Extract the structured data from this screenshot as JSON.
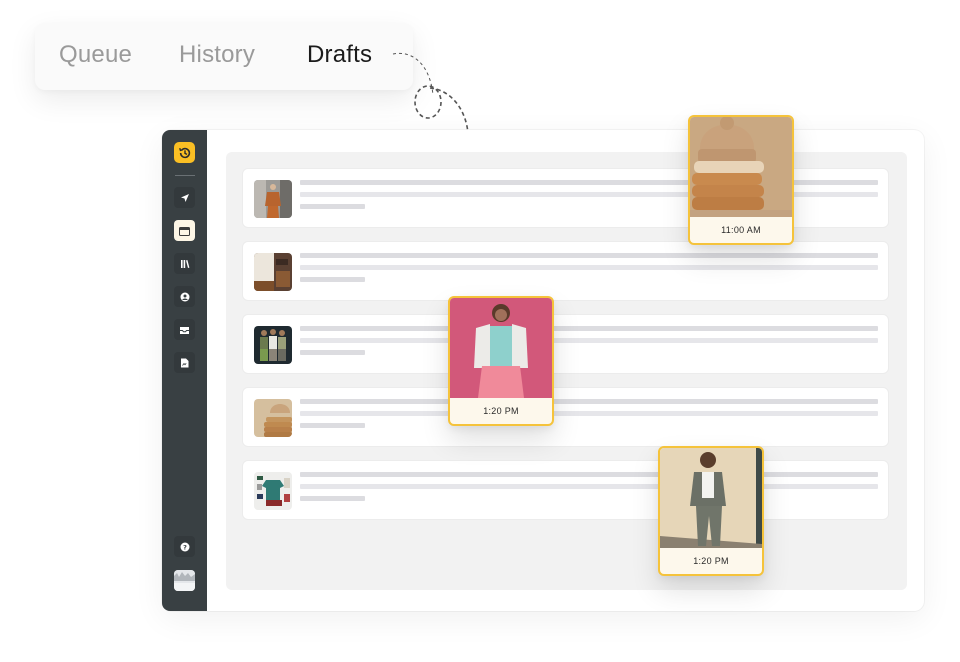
{
  "tabs": [
    {
      "label": "Queue",
      "active": false
    },
    {
      "label": "History",
      "active": false
    },
    {
      "label": "Drafts",
      "active": true
    }
  ],
  "sidebar": {
    "logo_icon": "history-clock-icon",
    "items": [
      {
        "icon": "send-icon",
        "active": false
      },
      {
        "icon": "calendar-icon",
        "active": true
      },
      {
        "icon": "library-icon",
        "active": false
      },
      {
        "icon": "user-circle-icon",
        "active": false
      },
      {
        "icon": "inbox-icon",
        "active": false
      },
      {
        "icon": "document-icon",
        "active": false
      }
    ],
    "help_icon": "help-icon",
    "avatar": "user-avatar"
  },
  "drafts": [
    {
      "thumbnail": "woman-in-rust-suit"
    },
    {
      "thumbnail": "apparel-flatlay-boots"
    },
    {
      "thumbnail": "three-men-group"
    },
    {
      "thumbnail": "knit-beanie-stack"
    },
    {
      "thumbnail": "green-jacket-flatlay"
    }
  ],
  "scheduled_cards": [
    {
      "time": "11:00 AM",
      "image": "knit-beanie-stack",
      "accent": "#f5c33b"
    },
    {
      "time": "1:20 PM",
      "image": "woman-pink-background",
      "accent": "#f5c33b"
    },
    {
      "time": "1:20 PM",
      "image": "person-grey-tracksuit",
      "accent": "#f5c33b"
    }
  ],
  "colors": {
    "accent": "#fbbf24",
    "sidebar": "#394043",
    "card_border": "#f5c33b"
  }
}
